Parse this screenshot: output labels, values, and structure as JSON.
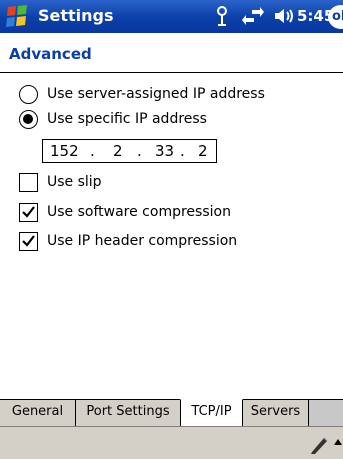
{
  "titlebar": {
    "title": "Settings",
    "time": "5:45",
    "ok_label": "ok",
    "icons": [
      "start-flag-icon",
      "antenna-icon",
      "sync-arrows-icon",
      "volume-icon"
    ]
  },
  "page": {
    "title": "Advanced"
  },
  "options": {
    "server_ip": {
      "label": "Use server-assigned IP address",
      "selected": false
    },
    "specific_ip": {
      "label": "Use specific IP address",
      "selected": true
    },
    "ip_address": [
      "152",
      "2",
      "33",
      "2"
    ],
    "use_slip": {
      "label": "Use slip",
      "checked": false
    },
    "software_compression": {
      "label": "Use software compression",
      "checked": true
    },
    "ip_header_compression": {
      "label": "Use IP header compression",
      "checked": true
    }
  },
  "tabs": [
    {
      "label": "General",
      "active": false
    },
    {
      "label": "Port Settings",
      "active": false
    },
    {
      "label": "TCP/IP",
      "active": true
    },
    {
      "label": "Servers",
      "active": false
    }
  ],
  "cmdbar": {
    "icons": [
      "pen-icon",
      "sip-arrow-icon"
    ]
  },
  "colors": {
    "titlebar": "#0b3fa8",
    "header_text": "#0b3fa8",
    "tab_bar": "#d4d0c8"
  }
}
